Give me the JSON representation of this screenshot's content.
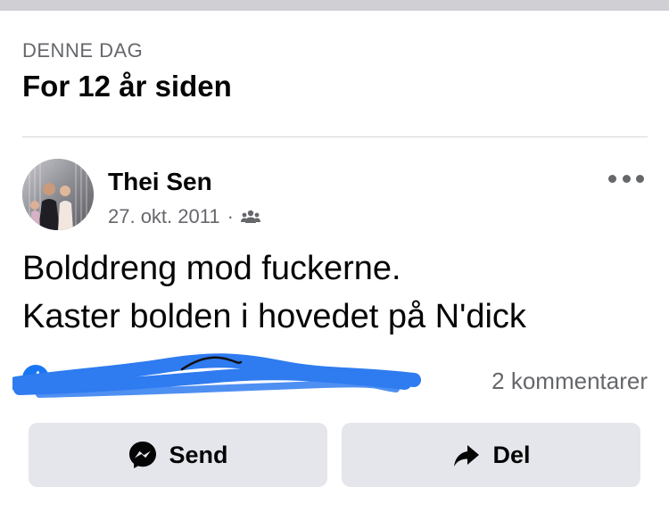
{
  "memory": {
    "eyebrow": "DENNE DAG",
    "headline": "For 12 år siden"
  },
  "post": {
    "author": "Thei Sen",
    "date": "27. okt. 2011",
    "separator": "·",
    "audience_icon": "friends-icon",
    "lines": [
      "Bolddreng mod fuckerne.",
      "Kaster bolden i hovedet på N'dick"
    ]
  },
  "engagement": {
    "reactions_text": "",
    "comments": "2 kommentarer"
  },
  "actions": {
    "send_label": "Send",
    "send_icon": "messenger-icon",
    "share_label": "Del",
    "share_icon": "share-arrow-icon"
  },
  "colors": {
    "scribble": "#2f7bf0",
    "button_bg": "#e4e6eb",
    "secondary_text": "#65676b"
  }
}
